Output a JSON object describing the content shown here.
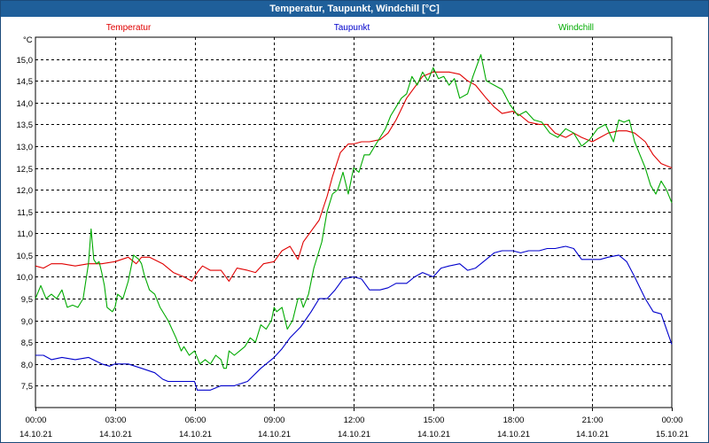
{
  "window": {
    "title": "Temperatur, Taupunkt, Windchill [°C]"
  },
  "chart_data": {
    "type": "line",
    "title": "Temperatur, Taupunkt, Windchill [°C]",
    "ylabel": "°C",
    "ylim": [
      7.0,
      15.5
    ],
    "yticks": [
      "7,5",
      "8,0",
      "8,5",
      "9,0",
      "9,5",
      "10,0",
      "10,5",
      "11,0",
      "11,5",
      "12,0",
      "12,5",
      "13,0",
      "13,5",
      "14,0",
      "14,5",
      "15,0"
    ],
    "xlim": [
      0,
      24
    ],
    "xticks": [
      {
        "time": "00:00",
        "date": "14.10.21"
      },
      {
        "time": "03:00",
        "date": "14.10.21"
      },
      {
        "time": "06:00",
        "date": "14.10.21"
      },
      {
        "time": "09:00",
        "date": "14.10.21"
      },
      {
        "time": "12:00",
        "date": "14.10.21"
      },
      {
        "time": "15:00",
        "date": "14.10.21"
      },
      {
        "time": "18:00",
        "date": "14.10.21"
      },
      {
        "time": "21:00",
        "date": "14.10.21"
      },
      {
        "time": "00:00",
        "date": "15.10.21"
      }
    ],
    "grid": true,
    "legend_position": "top",
    "series": [
      {
        "name": "Temperatur",
        "color": "#e00000",
        "x": [
          0,
          0.3,
          0.6,
          1.0,
          1.5,
          2.0,
          2.5,
          3.0,
          3.5,
          3.8,
          4.0,
          4.3,
          4.8,
          5.2,
          5.6,
          5.9,
          6.1,
          6.3,
          6.6,
          7.0,
          7.3,
          7.6,
          8.0,
          8.3,
          8.6,
          9.0,
          9.3,
          9.6,
          9.9,
          10.1,
          10.4,
          10.7,
          11.0,
          11.2,
          11.5,
          11.8,
          12.0,
          12.3,
          12.6,
          13.0,
          13.3,
          13.6,
          14.0,
          14.3,
          14.6,
          15.0,
          15.3,
          15.6,
          16.0,
          16.3,
          16.6,
          17.0,
          17.3,
          17.6,
          18.0,
          18.3,
          18.6,
          19.0,
          19.3,
          19.6,
          20.0,
          20.3,
          20.6,
          21.0,
          21.3,
          21.6,
          22.0,
          22.3,
          22.6,
          23.0,
          23.3,
          23.6,
          24.0
        ],
        "values": [
          10.25,
          10.2,
          10.3,
          10.3,
          10.25,
          10.3,
          10.3,
          10.35,
          10.45,
          10.3,
          10.45,
          10.45,
          10.3,
          10.1,
          10.0,
          9.9,
          10.1,
          10.25,
          10.15,
          10.15,
          9.9,
          10.2,
          10.15,
          10.1,
          10.3,
          10.35,
          10.6,
          10.7,
          10.4,
          10.8,
          11.05,
          11.3,
          11.85,
          12.3,
          12.85,
          13.05,
          13.05,
          13.1,
          13.1,
          13.15,
          13.3,
          13.6,
          14.1,
          14.35,
          14.6,
          14.7,
          14.7,
          14.7,
          14.65,
          14.5,
          14.4,
          14.1,
          13.9,
          13.75,
          13.8,
          13.7,
          13.55,
          13.5,
          13.5,
          13.3,
          13.2,
          13.3,
          13.2,
          13.1,
          13.2,
          13.3,
          13.35,
          13.35,
          13.3,
          13.1,
          12.8,
          12.6,
          12.5
        ]
      },
      {
        "name": "Taupunkt",
        "color": "#0000cc",
        "x": [
          0,
          0.3,
          0.6,
          1.0,
          1.5,
          2.0,
          2.5,
          2.8,
          3.0,
          3.5,
          4.0,
          4.5,
          4.8,
          5.0,
          5.5,
          6.0,
          6.1,
          6.3,
          6.6,
          7.0,
          7.5,
          8.0,
          8.5,
          9.0,
          9.3,
          9.6,
          10.0,
          10.4,
          10.7,
          11.0,
          11.3,
          11.6,
          12.0,
          12.3,
          12.6,
          13.0,
          13.3,
          13.6,
          14.0,
          14.3,
          14.6,
          15.0,
          15.3,
          15.6,
          16.0,
          16.3,
          16.6,
          17.0,
          17.3,
          17.6,
          18.0,
          18.3,
          18.6,
          19.0,
          19.3,
          19.6,
          20.0,
          20.3,
          20.6,
          21.0,
          21.3,
          21.6,
          22.0,
          22.3,
          22.6,
          23.0,
          23.3,
          23.6,
          24.0
        ],
        "values": [
          8.2,
          8.2,
          8.1,
          8.15,
          8.1,
          8.15,
          8.0,
          7.95,
          8.0,
          8.0,
          7.9,
          7.8,
          7.65,
          7.6,
          7.6,
          7.6,
          7.4,
          7.4,
          7.4,
          7.5,
          7.5,
          7.6,
          7.9,
          8.15,
          8.35,
          8.6,
          8.85,
          9.2,
          9.5,
          9.5,
          9.7,
          9.95,
          10.0,
          9.95,
          9.7,
          9.7,
          9.75,
          9.85,
          9.85,
          10.0,
          10.1,
          10.0,
          10.2,
          10.25,
          10.3,
          10.15,
          10.2,
          10.4,
          10.55,
          10.6,
          10.6,
          10.55,
          10.6,
          10.6,
          10.65,
          10.65,
          10.7,
          10.65,
          10.4,
          10.4,
          10.4,
          10.45,
          10.5,
          10.35,
          10.0,
          9.5,
          9.2,
          9.15,
          8.45
        ]
      },
      {
        "name": "Windchill",
        "color": "#00aa00",
        "x": [
          0,
          0.2,
          0.4,
          0.6,
          0.8,
          1.0,
          1.2,
          1.4,
          1.6,
          1.8,
          2.0,
          2.1,
          2.2,
          2.3,
          2.4,
          2.5,
          2.6,
          2.7,
          2.9,
          3.0,
          3.1,
          3.3,
          3.5,
          3.7,
          3.9,
          4.0,
          4.1,
          4.3,
          4.5,
          4.7,
          5.0,
          5.3,
          5.5,
          5.6,
          5.8,
          6.0,
          6.2,
          6.4,
          6.6,
          6.8,
          7.0,
          7.1,
          7.2,
          7.3,
          7.5,
          7.7,
          7.9,
          8.1,
          8.3,
          8.5,
          8.7,
          8.9,
          9.0,
          9.1,
          9.3,
          9.5,
          9.7,
          9.9,
          10.0,
          10.1,
          10.3,
          10.5,
          10.8,
          11.0,
          11.2,
          11.4,
          11.6,
          11.8,
          12.0,
          12.2,
          12.4,
          12.6,
          12.8,
          13.0,
          13.2,
          13.4,
          13.6,
          13.8,
          14.0,
          14.2,
          14.4,
          14.6,
          14.8,
          15.0,
          15.2,
          15.4,
          15.6,
          15.8,
          16.0,
          16.3,
          16.5,
          16.8,
          17.0,
          17.3,
          17.6,
          17.9,
          18.2,
          18.5,
          18.8,
          19.1,
          19.4,
          19.7,
          20.0,
          20.3,
          20.6,
          20.9,
          21.2,
          21.5,
          21.8,
          22.0,
          22.2,
          22.4,
          22.6,
          22.8,
          23.0,
          23.2,
          23.4,
          23.6,
          23.8,
          24.0
        ],
        "values": [
          9.5,
          9.8,
          9.5,
          9.6,
          9.5,
          9.7,
          9.3,
          9.35,
          9.3,
          9.5,
          10.3,
          11.1,
          10.4,
          10.3,
          10.35,
          10.1,
          9.8,
          9.3,
          9.2,
          9.3,
          9.6,
          9.5,
          9.9,
          10.5,
          10.4,
          10.3,
          10.05,
          9.7,
          9.6,
          9.3,
          9.0,
          8.6,
          8.3,
          8.4,
          8.2,
          8.3,
          8.0,
          8.1,
          8.0,
          8.2,
          8.1,
          7.9,
          7.9,
          8.3,
          8.2,
          8.3,
          8.4,
          8.6,
          8.5,
          8.9,
          8.8,
          9.0,
          9.3,
          9.2,
          9.3,
          8.8,
          9.0,
          9.5,
          9.5,
          9.3,
          9.6,
          10.2,
          10.8,
          11.5,
          11.9,
          12.0,
          12.4,
          11.9,
          12.5,
          12.4,
          12.8,
          12.8,
          13.0,
          13.2,
          13.4,
          13.7,
          13.9,
          14.1,
          14.2,
          14.6,
          14.4,
          14.7,
          14.5,
          14.8,
          14.55,
          14.6,
          14.4,
          14.55,
          14.1,
          14.2,
          14.6,
          15.1,
          14.5,
          14.4,
          14.3,
          13.95,
          13.7,
          13.8,
          13.6,
          13.55,
          13.3,
          13.2,
          13.4,
          13.3,
          13.0,
          13.15,
          13.4,
          13.5,
          13.1,
          13.6,
          13.55,
          13.6,
          13.1,
          12.8,
          12.5,
          12.1,
          11.9,
          12.2,
          12.0,
          11.7
        ]
      }
    ]
  }
}
